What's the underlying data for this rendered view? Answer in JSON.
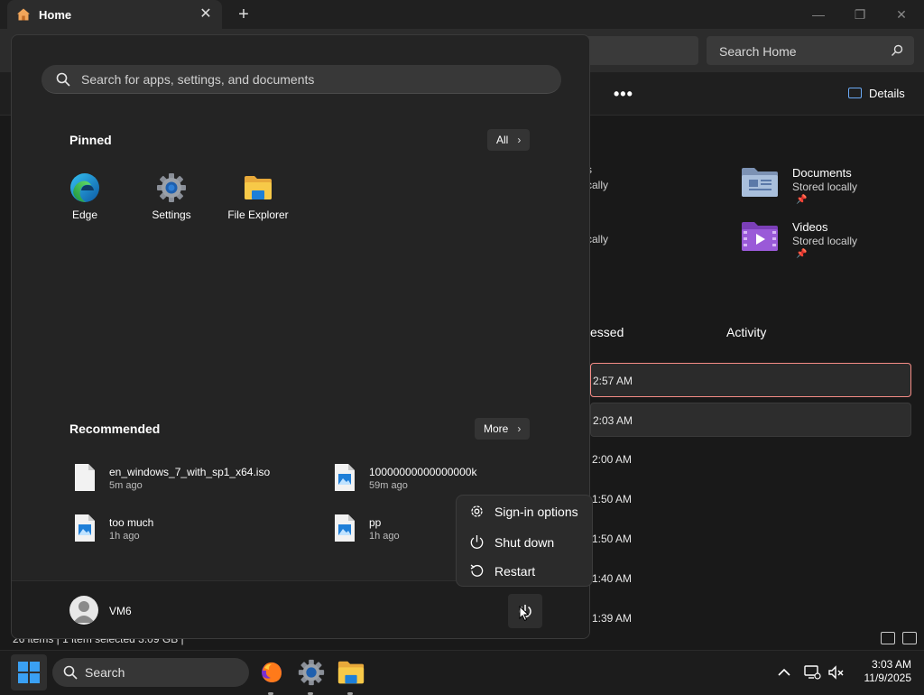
{
  "explorer": {
    "tab_title": "Home",
    "tab_close": "✕",
    "new_tab": "+",
    "win_min": "—",
    "win_max": "❐",
    "win_close": "✕",
    "search_placeholder": "Search Home",
    "more": "•••",
    "details": "Details",
    "quick_access": [
      {
        "name": "Documents",
        "sub": "Stored locally",
        "pin": "📌"
      },
      {
        "name": "Videos",
        "sub": "Stored locally",
        "pin": "📌"
      }
    ],
    "partial_text": [
      "s",
      "cally",
      "cally"
    ],
    "col_accessed": "essed",
    "col_activity": "Activity",
    "rows": [
      "2:57 AM",
      "2:03 AM",
      "2:00 AM",
      "1:50 AM",
      "1:50 AM",
      "1:40 AM",
      "1:39 AM"
    ],
    "status": "26 items  |  1 item selected  3.09 GB  |"
  },
  "start_menu": {
    "search_placeholder": "Search for apps, settings, and documents",
    "pinned_title": "Pinned",
    "all_button": "All",
    "pinned": [
      {
        "label": "Edge",
        "icon": "edge-icon"
      },
      {
        "label": "Settings",
        "icon": "settings-gear-icon"
      },
      {
        "label": "File Explorer",
        "icon": "folder-icon"
      }
    ],
    "recommended_title": "Recommended",
    "more_button": "More",
    "recommended": [
      {
        "name": "en_windows_7_with_sp1_x64.iso",
        "time": "5m ago",
        "icon": "file-icon"
      },
      {
        "name": "10000000000000000k",
        "time": "59m ago",
        "icon": "image-file-icon"
      },
      {
        "name": "too much",
        "time": "1h ago",
        "icon": "image-file-icon"
      },
      {
        "name": "pp",
        "time": "1h ago",
        "icon": "image-file-icon"
      }
    ],
    "user": "VM6",
    "power_menu": [
      {
        "label": "Sign-in options",
        "icon": "gear-icon"
      },
      {
        "label": "Shut down",
        "icon": "power-icon"
      },
      {
        "label": "Restart",
        "icon": "restart-icon"
      }
    ]
  },
  "taskbar": {
    "search_label": "Search",
    "apps": [
      "firefox-icon",
      "settings-gear-icon",
      "folder-icon"
    ],
    "time": "3:03 AM",
    "date": "11/9/2025"
  },
  "colors": {
    "accent_blue": "#0a84ff",
    "selection_border": "#f58c86",
    "folder_yellow": "#f7c948"
  }
}
